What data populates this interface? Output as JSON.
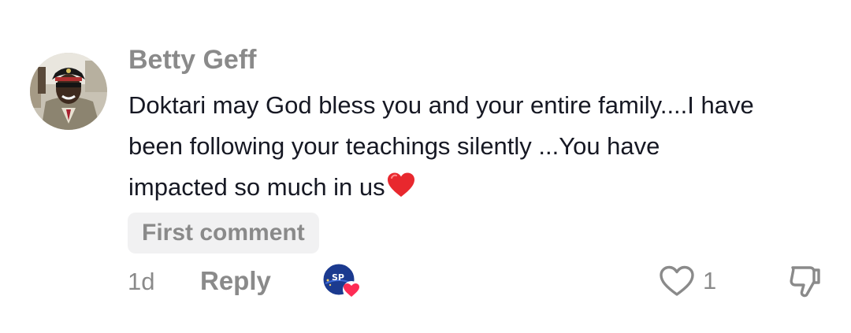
{
  "comment": {
    "username": "Betty Geff",
    "text_lines": [
      "Doktari may God bless you and your entire family....I have",
      "been following your teachings silently ...You have",
      "impacted so much in us"
    ],
    "emoji": "heart-emoji",
    "badge": "First comment",
    "time": "1d",
    "reply_label": "Reply",
    "creator_like_text": "SP",
    "like_count": "1"
  },
  "icons": {
    "like": "heart-outline-icon",
    "dislike": "thumbs-down-icon",
    "creator_like": "creator-liked-avatar-icon"
  },
  "colors": {
    "username": "#8a8a8a",
    "text": "#161823",
    "muted": "#8a8a8a",
    "badge_bg": "#f1f1f2",
    "heart": "#fe2c55"
  }
}
